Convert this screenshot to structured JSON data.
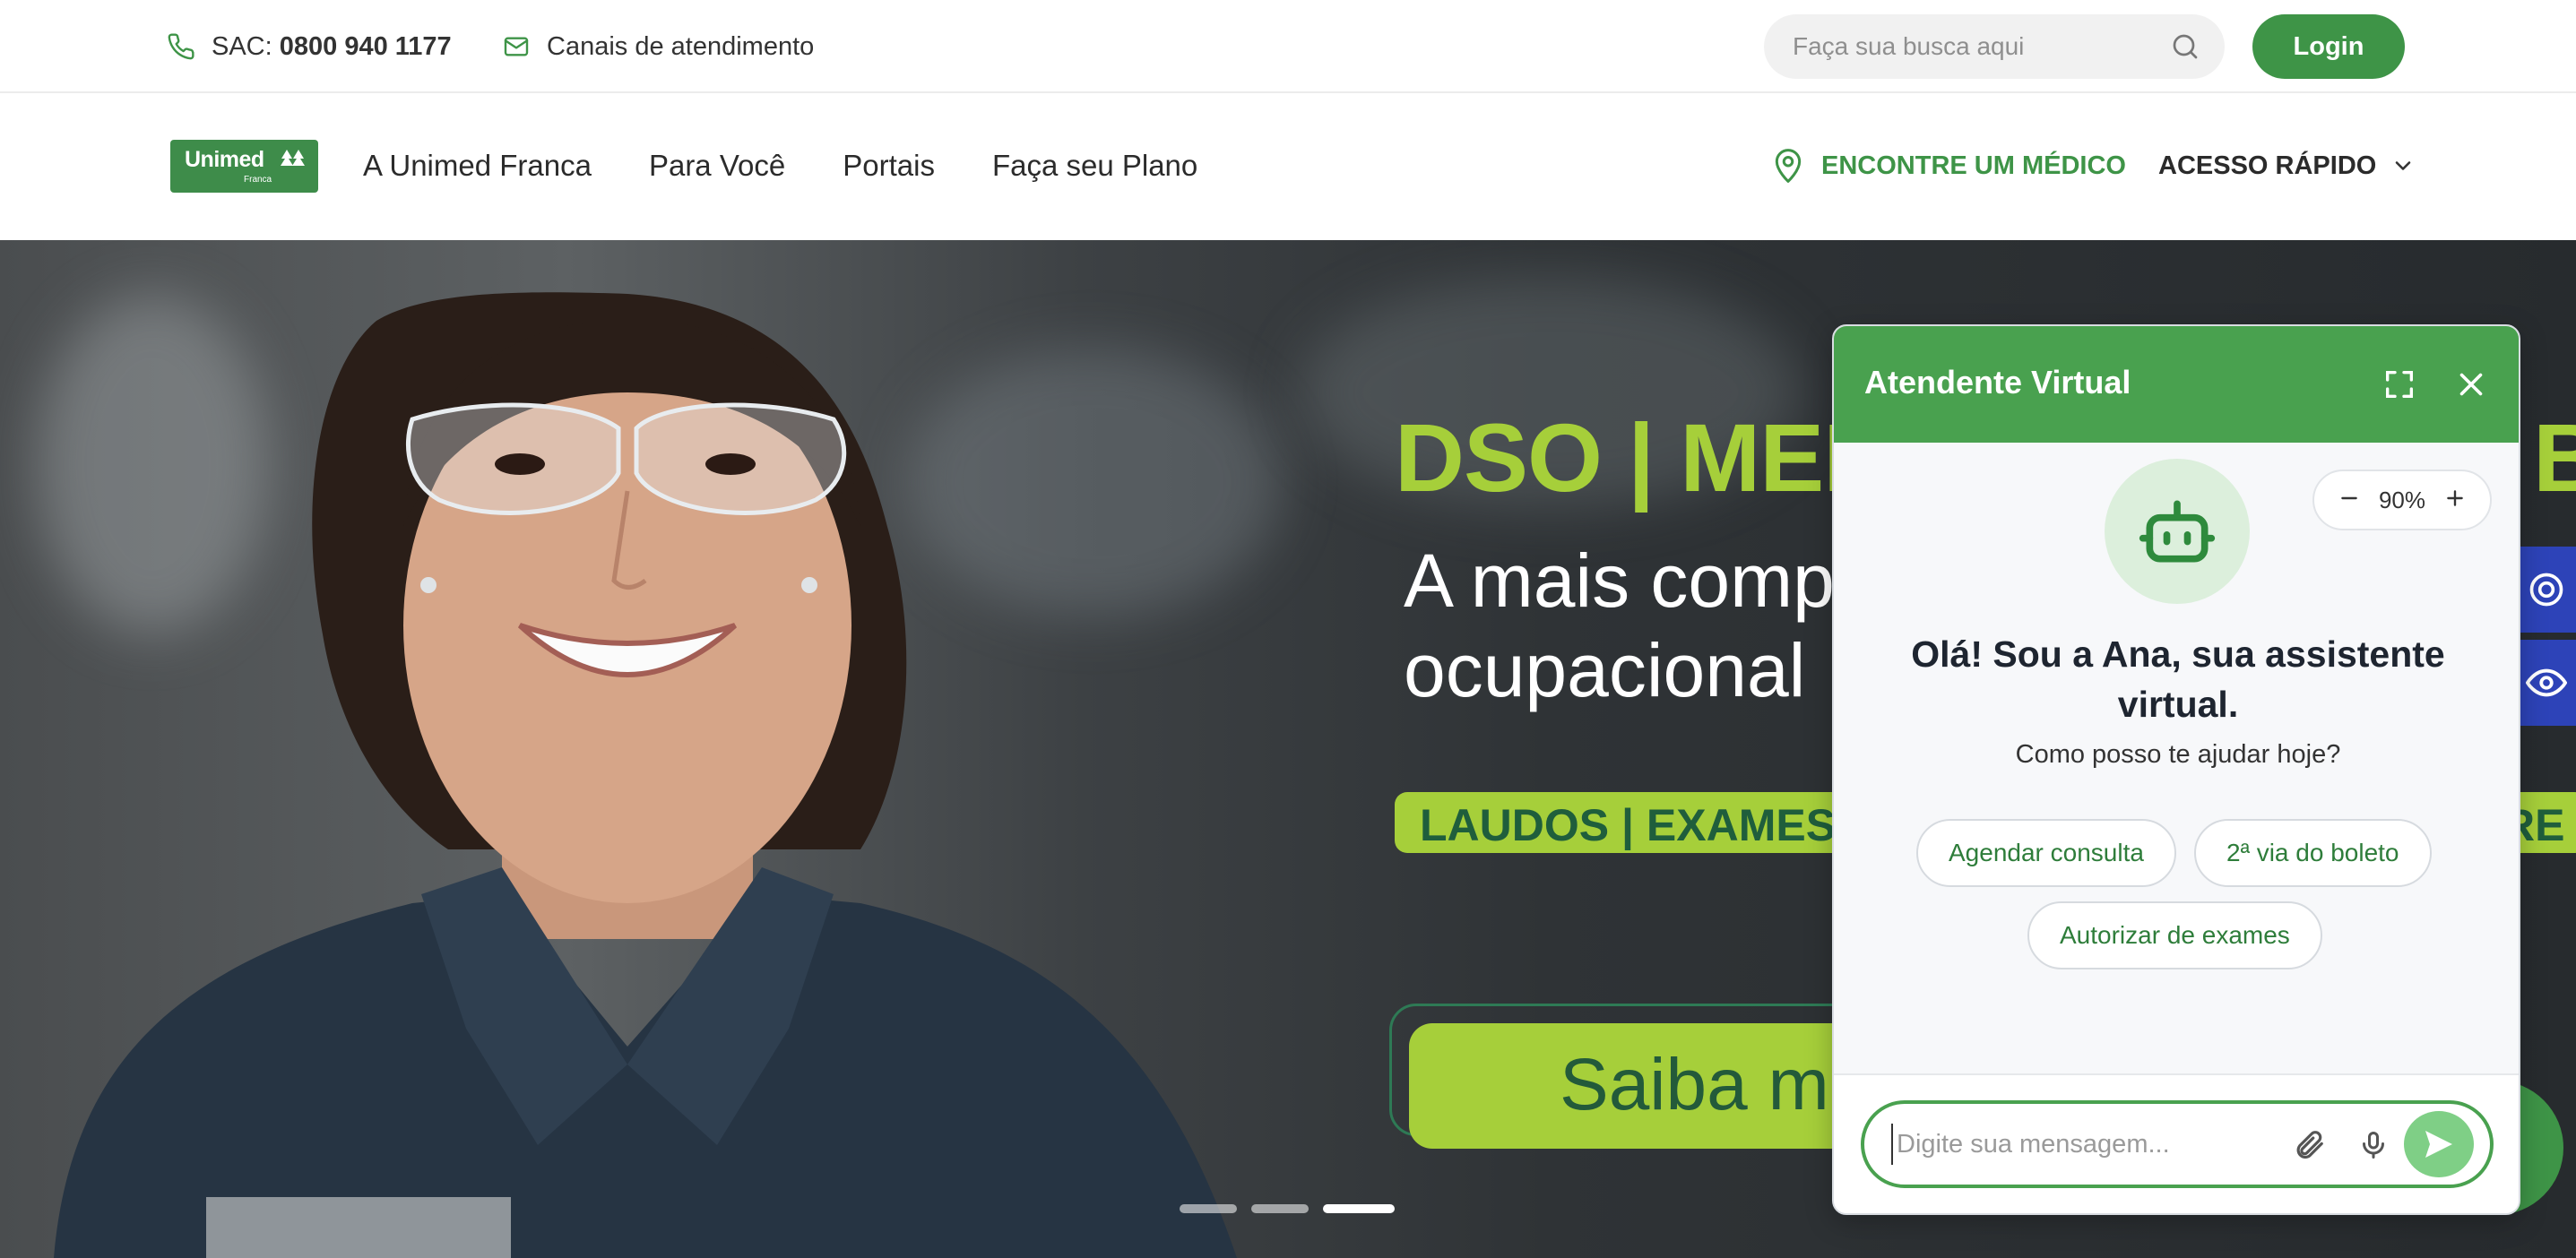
{
  "topbar": {
    "sac_label": "SAC: ",
    "sac_number": "0800 940 1177",
    "canais": "Canais de atendimento",
    "search_placeholder": "Faça sua busca aqui",
    "login": "Login"
  },
  "nav": {
    "logo_text": "Unimed",
    "logo_sub": "Franca",
    "links": [
      "A Unimed Franca",
      "Para Você",
      "Portais",
      "Faça seu Plano"
    ],
    "encontre": "ENCONTRE UM MÉDICO",
    "acesso": "ACESSO RÁPIDO"
  },
  "hero": {
    "headline": "DSO | MED",
    "headline_tail": "BA",
    "sub_line1": "A mais comp",
    "sub_line2": "ocupacional",
    "band": "LAUDOS | EXAMES C",
    "band_tail": "RE",
    "cta": "Saiba ma",
    "slides": 3,
    "active_slide": 3
  },
  "chat": {
    "title": "Atendente Virtual",
    "zoom": "90%",
    "greeting": "Olá! Sou a Ana, sua assistente virtual.",
    "help": "Como posso te ajudar hoje?",
    "chips": [
      "Agendar consulta",
      "2ª via do boleto",
      "Autorizar de exames"
    ],
    "input_placeholder": "Digite sua mensagem..."
  },
  "colors": {
    "brand_green": "#3e9447",
    "chat_green": "#49a14f",
    "lime": "#a6cf3a",
    "a11y_blue": "#2d43b8"
  },
  "icons": [
    "phone-icon",
    "mail-icon",
    "search-icon",
    "location-pin-icon",
    "chevron-down-icon",
    "expand-icon",
    "close-icon",
    "robot-icon",
    "minus-icon",
    "plus-icon",
    "paperclip-icon",
    "microphone-icon",
    "send-icon",
    "eye-icon"
  ]
}
